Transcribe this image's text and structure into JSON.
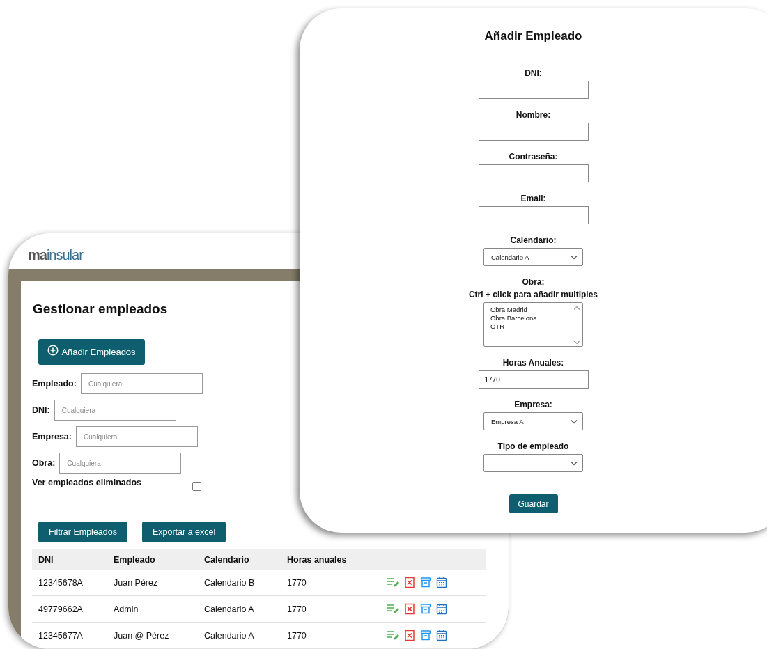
{
  "employees_window": {
    "logo": {
      "part_1": "ma",
      "part_2": "insular"
    },
    "title": "Gestionar empleados",
    "add_button": "Añadir Empleados",
    "filters": [
      {
        "label": "Empleado:",
        "placeholder": "Cualquiera"
      },
      {
        "label": "DNI:",
        "placeholder": "Cualquiera"
      },
      {
        "label": "Empresa:",
        "placeholder": "Cualquiera"
      },
      {
        "label": "Obra:",
        "placeholder": "Cualquiera"
      }
    ],
    "show_deleted": {
      "label": "Ver empleados eliminados",
      "checked": false
    },
    "buttons": [
      "Filtrar Empleados",
      "Exportar a excel"
    ],
    "table": {
      "columns": [
        "DNI",
        "Empleado",
        "Calendario",
        "Horas anuales"
      ],
      "rows": [
        {
          "cells": [
            "12345678A",
            "Juan Pérez",
            "Calendario B",
            "1770"
          ]
        },
        {
          "cells": [
            "49779662A",
            "Admin",
            "Calendario A",
            "1770"
          ]
        },
        {
          "cells": [
            "12345677A",
            "Juan @ Pérez",
            "Calendario A",
            "1770"
          ]
        }
      ]
    }
  },
  "add_employee_window": {
    "title": "Añadir Empleado",
    "fields": [
      {
        "kind": "text",
        "label": "DNI:"
      },
      {
        "kind": "text",
        "label": "Nombre:"
      },
      {
        "kind": "text",
        "label": "Contraseña:"
      },
      {
        "kind": "text",
        "label": "Email:"
      },
      {
        "kind": "select",
        "label": "Calendario:",
        "value": "Calendario A"
      },
      {
        "kind": "multiselect",
        "label": "Obra:",
        "hint": "Ctrl + click para añadir multiples",
        "options": [
          "Obra Madrid",
          "Obra Barcelona",
          "OTR"
        ]
      },
      {
        "kind": "text",
        "label": "Horas Anuales:",
        "value": "1770"
      },
      {
        "kind": "select",
        "label": "Empresa:",
        "value": "Empresa A"
      },
      {
        "kind": "select",
        "label": "Tipo de empleado"
      }
    ],
    "save_button": "Guardar"
  }
}
